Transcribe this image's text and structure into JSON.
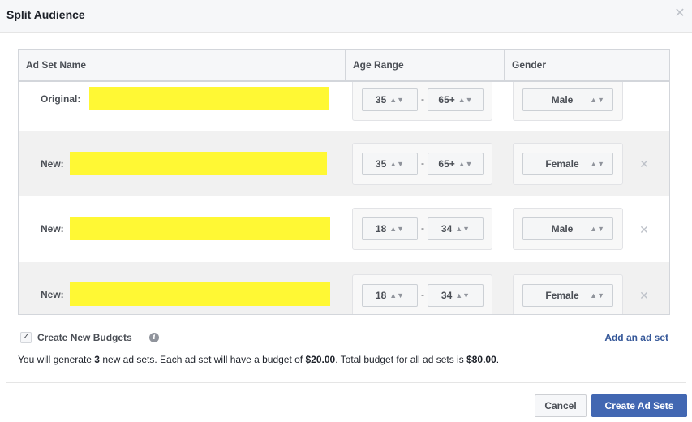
{
  "dialog": {
    "title": "Split Audience",
    "close_icon": "close-icon"
  },
  "table": {
    "headers": {
      "name": "Ad Set Name",
      "age": "Age Range",
      "gender": "Gender"
    },
    "rows": [
      {
        "label": "Original:",
        "name_redacted": true,
        "age_min": "35",
        "age_max": "65+",
        "gender": "Male",
        "removable": false
      },
      {
        "label": "New:",
        "name_redacted": true,
        "age_min": "35",
        "age_max": "65+",
        "gender": "Female",
        "removable": true
      },
      {
        "label": "New:",
        "name_redacted": true,
        "age_min": "18",
        "age_max": "34",
        "gender": "Male",
        "removable": true
      },
      {
        "label": "New:",
        "name_redacted": true,
        "age_min": "18",
        "age_max": "34",
        "gender": "Female",
        "removable": true
      }
    ],
    "age_separator": "-",
    "select_arrow_icon": "updown-arrows-icon",
    "remove_icon": "close-icon"
  },
  "budget": {
    "checkbox_checked": true,
    "label": "Create New Budgets",
    "info_icon": "info-icon",
    "add_link": "Add an ad set"
  },
  "summary": {
    "part1": "You will generate ",
    "count": "3",
    "part2": " new ad sets. Each ad set will have a budget of ",
    "per_budget": "$20.00",
    "part3": ". Total budget for all ad sets is ",
    "total_budget": "$80.00",
    "part4": "."
  },
  "footer": {
    "cancel_label": "Cancel",
    "create_label": "Create Ad Sets"
  },
  "colors": {
    "primary": "#4267b2",
    "link": "#365899",
    "redaction": "#fff834",
    "row_alt": "#f1f1f1"
  }
}
